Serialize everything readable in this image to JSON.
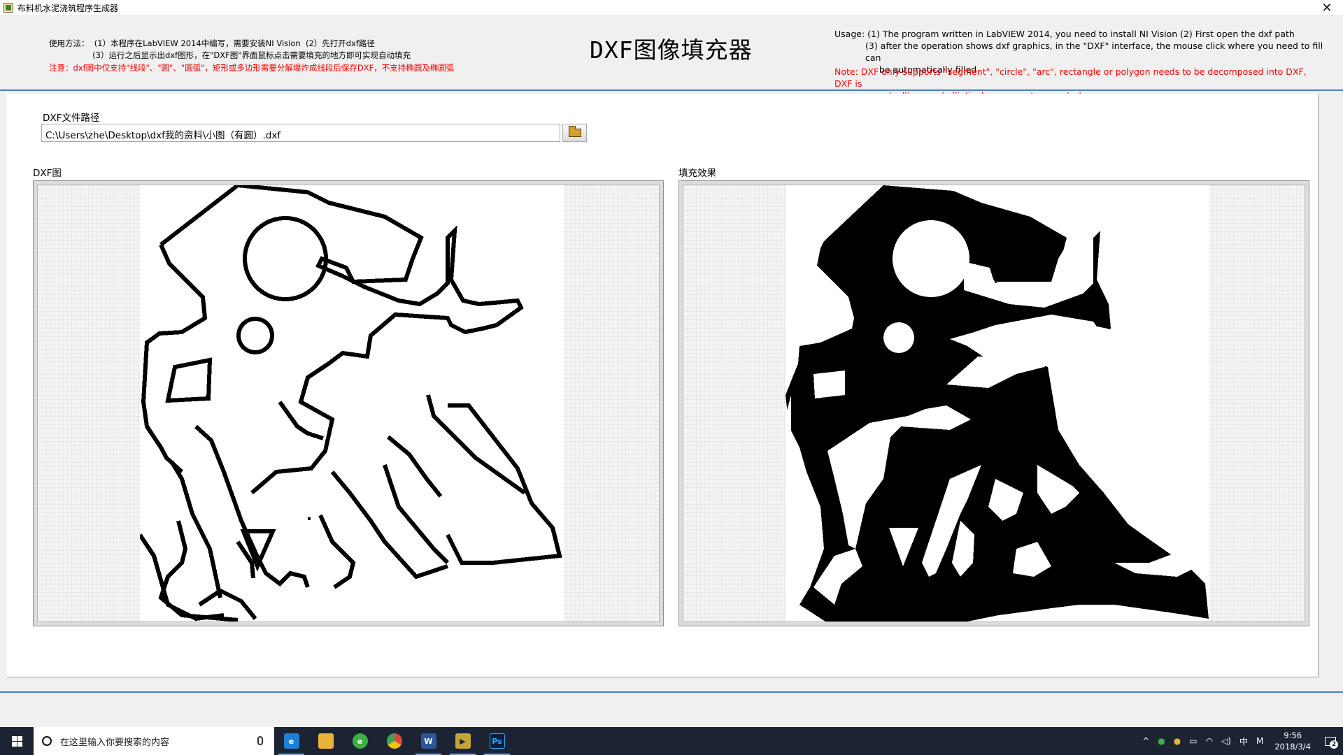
{
  "window": {
    "title": "布料机水泥浇筑程序生成器",
    "close": "✕"
  },
  "header": {
    "zh_usage_1": "使用方法：  (1）本程序在LabVIEW 2014中编写，需要安装NI Vision  (2）先打开dxf路径",
    "zh_usage_2": "                 (3）运行之后显示出dxf图形，在\"DXF图\"界面鼠标点击需要填充的地方即可实现自动填充",
    "zh_note": "注意：dxf图中仅支持\"线段\"、\"圆\"、\"圆弧\"，矩形或多边形需要分解爆炸成线段后保存DXF，不支持椭圆及椭圆弧",
    "app_title": "DXF图像填充器",
    "en_usage_1": "Usage: (1) The program written in LabVIEW 2014, you need to install NI Vision (2) First open the dxf path",
    "en_usage_2": "(3) after the operation shows dxf graphics, in the \"DXF\" interface, the mouse click where you need to fill can",
    "en_usage_3": "be automatically filled",
    "en_note_1": "Note: DXF only supports \"segment\", \"circle\", \"arc\", rectangle or polygon needs to be decomposed into DXF, DXF is",
    "en_note_2": "saved, ellipse and elliptical arc are not supported"
  },
  "path": {
    "label": "DXF文件路径",
    "value": "C:\\Users\\zhe\\Desktop\\dxf我的资料\\小图（有圆）.dxf"
  },
  "panels": {
    "dxf_label": "DXF图",
    "fill_label": "填充效果"
  },
  "taskbar": {
    "search_placeholder": "在这里输入你要搜索的内容",
    "apps": [
      {
        "name": "edge",
        "glyph": "e",
        "color": "#1e7fd6"
      },
      {
        "name": "explorer",
        "glyph": "",
        "color": "#e8b536"
      },
      {
        "name": "360",
        "glyph": "e",
        "color": "#3cb043"
      },
      {
        "name": "chrome",
        "glyph": "",
        "color": "#e0483a"
      },
      {
        "name": "word",
        "glyph": "W",
        "color": "#2b579a"
      },
      {
        "name": "labview",
        "glyph": "▶",
        "color": "#c6a43a"
      },
      {
        "name": "photoshop",
        "glyph": "Ps",
        "color": "#0a1e3c"
      }
    ],
    "ime": "中",
    "ime2": "M",
    "time": "9:56",
    "date": "2018/3/4",
    "notifications": "2"
  }
}
